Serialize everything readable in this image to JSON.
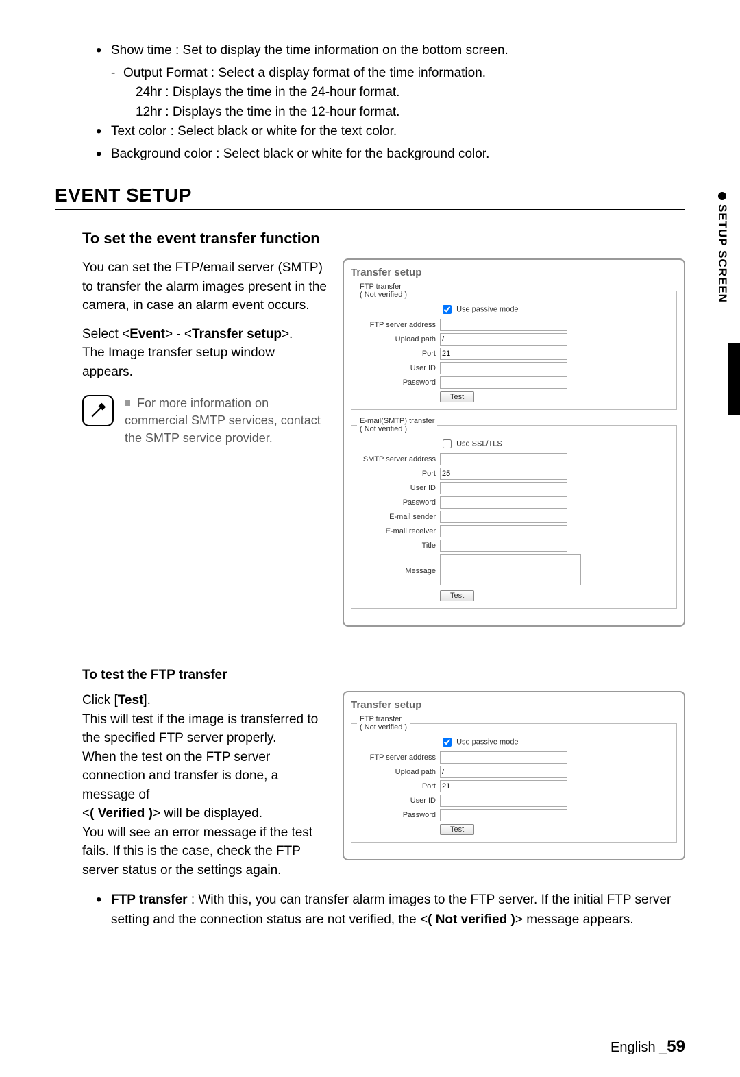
{
  "sideTab": "SETUP SCREEN",
  "topBullets": {
    "b1": "Show time : Set to display the time information on the bottom screen.",
    "d1": "Output Format : Select a display format of the time information.",
    "p1": "24hr : Displays the time in the 24-hour format.",
    "p2": "12hr : Displays the time in the 12-hour format.",
    "b2": "Text color : Select black or white for the text color.",
    "b3": "Background color : Select black or white for the background color."
  },
  "heading": "EVENT SETUP",
  "sub1": "To set the event transfer function",
  "intro1": "You can set the FTP/email server (SMTP) to transfer the alarm images present in the camera, in case an alarm event occurs.",
  "intro2a": "Select <",
  "intro2b": "Event",
  "intro2c": "> - <",
  "intro2d": "Transfer setup",
  "intro2e": ">.",
  "intro3": "The Image transfer setup window appears.",
  "note1": "For more information on commercial SMTP services, contact the SMTP service provider.",
  "panel": {
    "title": "Transfer setup",
    "ftp": {
      "legend": "FTP transfer",
      "status": "( Not verified )",
      "passive": "Use passive mode",
      "addr": "FTP server address",
      "addr_val": "",
      "path": "Upload path",
      "path_val": "/",
      "port": "Port",
      "port_val": "21",
      "user": "User ID",
      "user_val": "",
      "pw": "Password",
      "pw_val": "",
      "test": "Test"
    },
    "smtp": {
      "legend": "E-mail(SMTP) transfer",
      "status": "( Not verified )",
      "ssl": "Use SSL/TLS",
      "addr": "SMTP server address",
      "addr_val": "",
      "port": "Port",
      "port_val": "25",
      "user": "User ID",
      "user_val": "",
      "pw": "Password",
      "pw_val": "",
      "sender": "E-mail sender",
      "sender_val": "",
      "receiver": "E-mail receiver",
      "receiver_val": "",
      "title": "Title",
      "title_val": "",
      "msg": "Message",
      "msg_val": "",
      "test": "Test"
    }
  },
  "sub2": "To test the FTP transfer",
  "test1a": "Click [",
  "test1b": "Test",
  "test1c": "].",
  "test2": "This will test if the image is transferred to the specified FTP server properly.",
  "test3": "When the test on the FTP server connection and transfer is done, a message of",
  "test4a": "<",
  "test4b": "( Verified )",
  "test4c": "> will be displayed.",
  "test5": "You will see an error message if the test fails. If this is the case, check the FTP server status or the settings again.",
  "bottomBullet_a": "FTP transfer",
  "bottomBullet_b": " : With this, you can transfer alarm images to the FTP server. If the initial FTP server setting and the connection status are not verified, the <",
  "bottomBullet_c": "( Not verified )",
  "bottomBullet_d": "> message appears.",
  "footer_lang": "English _",
  "footer_page": "59"
}
